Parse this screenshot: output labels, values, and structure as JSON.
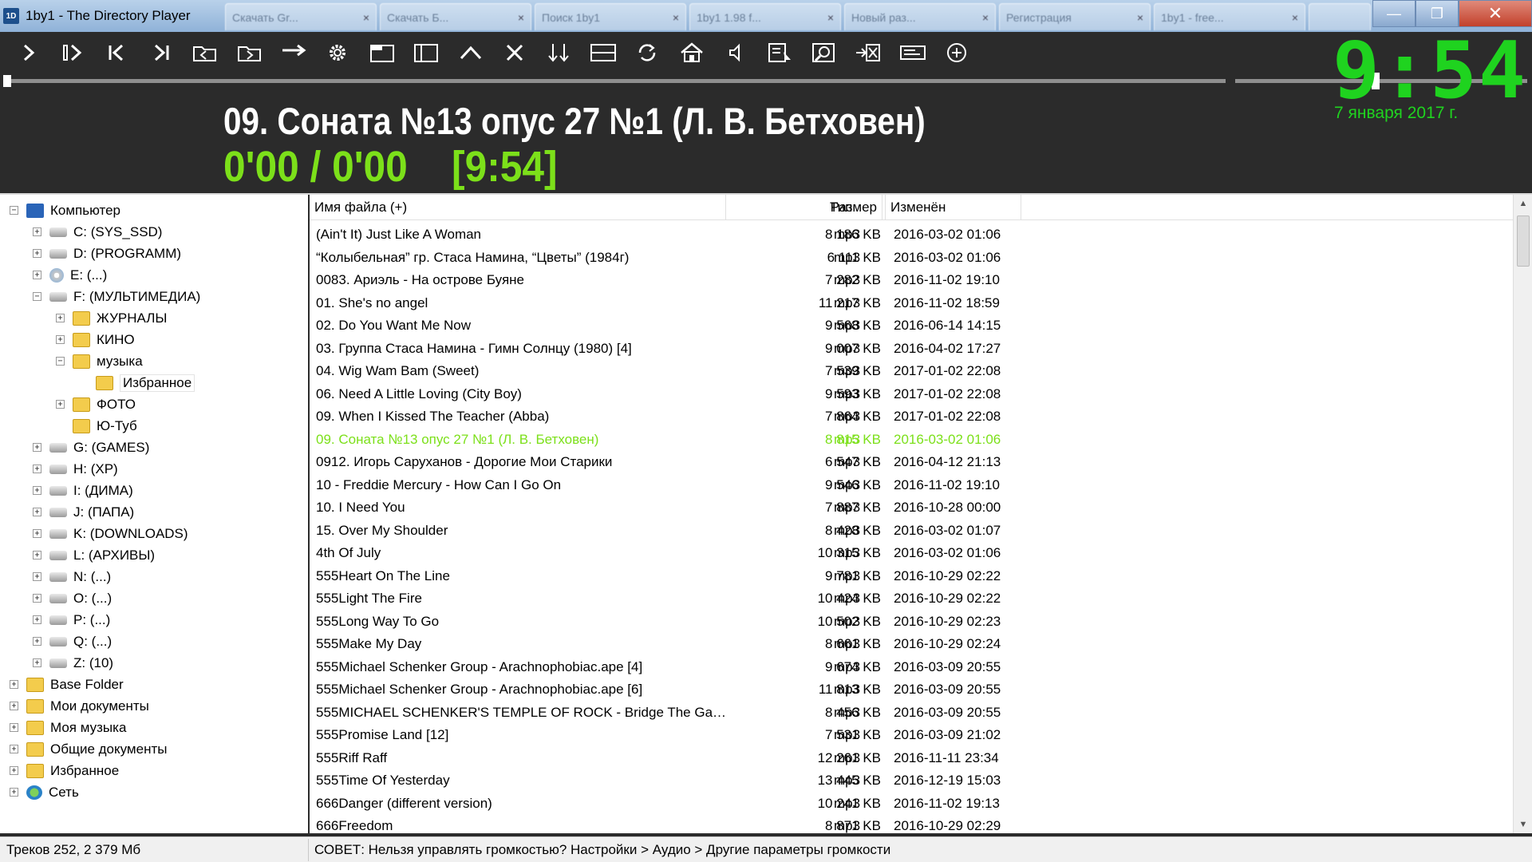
{
  "window": {
    "app_icon": "1D",
    "title": "1by1 - The Directory Player",
    "tabs": [
      {
        "label": "Скачать Gr..."
      },
      {
        "label": "Скачать Б..."
      },
      {
        "label": "Поиск 1by1"
      },
      {
        "label": "1by1 1.98 f..."
      },
      {
        "label": "Новый раз..."
      },
      {
        "label": "Регистрация"
      },
      {
        "label": "1by1 - free..."
      },
      {
        "label": ""
      }
    ],
    "minimize": "—",
    "restore": "❐",
    "close": "✕"
  },
  "toolbar": {
    "icons": [
      "play-icon",
      "play-pause-icon",
      "previous-track-icon",
      "next-track-icon",
      "back-folder-icon",
      "forward-folder-icon",
      "jump-icon",
      "settings-gear-icon",
      "window-layout-icon",
      "panel-icon",
      "up-icon",
      "stop-icon",
      "sort-icon",
      "split-view-icon",
      "refresh-icon",
      "home-icon",
      "volume-icon",
      "playlist-icon",
      "search-icon",
      "exit-icon",
      "keyboard-icon",
      "add-circle-icon"
    ],
    "seek_progress": 0,
    "volume_level": 0.48
  },
  "clock": {
    "time": "9:54",
    "date": "7 января 2017 г.",
    "color": "#1fd31f"
  },
  "now_playing": {
    "title": "09. Соната №13 опус 27 №1 (Л. В. Бетховен)",
    "position": "0'00 / 0'00    [9:54]",
    "color": "#7ce01a"
  },
  "tree": [
    {
      "label": "Компьютер",
      "level": 0,
      "expander": "−",
      "icon": "computer-icon"
    },
    {
      "label": "C: (SYS_SSD)",
      "level": 1,
      "expander": "+",
      "icon": "drive-icon"
    },
    {
      "label": "D: (PROGRAMM)",
      "level": 1,
      "expander": "+",
      "icon": "drive-icon"
    },
    {
      "label": "E: (...)",
      "level": 1,
      "expander": "+",
      "icon": "cd-drive-icon"
    },
    {
      "label": "F: (МУЛЬТИМЕДИА)",
      "level": 1,
      "expander": "−",
      "icon": "drive-icon"
    },
    {
      "label": "ЖУРНАЛЫ",
      "level": 2,
      "expander": "+",
      "icon": "folder-icon"
    },
    {
      "label": "КИНО",
      "level": 2,
      "expander": "+",
      "icon": "folder-icon"
    },
    {
      "label": "музыка",
      "level": 2,
      "expander": "−",
      "icon": "folder-icon"
    },
    {
      "label": "Избранное",
      "level": 3,
      "expander": "",
      "icon": "folder-icon",
      "selected": true
    },
    {
      "label": "ФОТО",
      "level": 2,
      "expander": "+",
      "icon": "folder-icon"
    },
    {
      "label": "Ю-Туб",
      "level": 2,
      "expander": "",
      "icon": "folder-icon"
    },
    {
      "label": "G: (GAMES)",
      "level": 1,
      "expander": "+",
      "icon": "drive-icon"
    },
    {
      "label": "H: (XP)",
      "level": 1,
      "expander": "+",
      "icon": "drive-icon"
    },
    {
      "label": "I: (ДИМА)",
      "level": 1,
      "expander": "+",
      "icon": "drive-icon"
    },
    {
      "label": "J: (ПАПА)",
      "level": 1,
      "expander": "+",
      "icon": "drive-icon"
    },
    {
      "label": "K: (DOWNLOADS)",
      "level": 1,
      "expander": "+",
      "icon": "drive-icon"
    },
    {
      "label": "L: (АРХИВЫ)",
      "level": 1,
      "expander": "+",
      "icon": "drive-icon"
    },
    {
      "label": "N: (...)",
      "level": 1,
      "expander": "+",
      "icon": "drive-icon"
    },
    {
      "label": "O: (...)",
      "level": 1,
      "expander": "+",
      "icon": "drive-icon"
    },
    {
      "label": "P: (...)",
      "level": 1,
      "expander": "+",
      "icon": "drive-icon"
    },
    {
      "label": "Q: (...)",
      "level": 1,
      "expander": "+",
      "icon": "drive-icon"
    },
    {
      "label": "Z: (10)",
      "level": 1,
      "expander": "+",
      "icon": "drive-icon"
    },
    {
      "label": "Base Folder",
      "level": 0,
      "expander": "+",
      "icon": "folder-icon"
    },
    {
      "label": "Мои документы",
      "level": 0,
      "expander": "+",
      "icon": "folder-icon"
    },
    {
      "label": "Моя музыка",
      "level": 0,
      "expander": "+",
      "icon": "folder-icon"
    },
    {
      "label": "Общие документы",
      "level": 0,
      "expander": "+",
      "icon": "folder-icon"
    },
    {
      "label": "Избранное",
      "level": 0,
      "expander": "+",
      "icon": "folder-icon"
    },
    {
      "label": "Сеть",
      "level": 0,
      "expander": "+",
      "icon": "network-icon"
    }
  ],
  "list": {
    "columns": {
      "name": "Имя файла (+)",
      "size": "Размер",
      "type": "Тип",
      "modified": "Изменён"
    },
    "rows": [
      {
        "name": "(Ain't It) Just Like A Woman",
        "size": "8 186 KB",
        "type": "mp3",
        "modified": "2016-03-02 01:06"
      },
      {
        "name": "“Колыбельная” гр. Стаса Намина, “Цветы” (1984г)",
        "size": "6 111 KB",
        "type": "mp3",
        "modified": "2016-03-02 01:06"
      },
      {
        "name": "0083. Ариэль - На острове Буяне",
        "size": "7 282 KB",
        "type": "mp3",
        "modified": "2016-11-02 19:10"
      },
      {
        "name": "01. She's no angel",
        "size": "11 217 KB",
        "type": "mp3",
        "modified": "2016-11-02 18:59"
      },
      {
        "name": "02. Do You Want Me Now",
        "size": "9 568 KB",
        "type": "mp3",
        "modified": "2016-06-14 14:15"
      },
      {
        "name": "03. Группа Стаса Намина - Гимн Солнцу (1980) [4]",
        "size": "9 007 KB",
        "type": "mp3",
        "modified": "2016-04-02 17:27"
      },
      {
        "name": "04. Wig Wam Bam (Sweet)",
        "size": "7 539 KB",
        "type": "mp3",
        "modified": "2017-01-02 22:08"
      },
      {
        "name": "06. Need A Little Loving (City Boy)",
        "size": "9 593 KB",
        "type": "mp3",
        "modified": "2017-01-02 22:08"
      },
      {
        "name": "09. When I Kissed The Teacher (Abba)",
        "size": "7 864 KB",
        "type": "mp3",
        "modified": "2017-01-02 22:08"
      },
      {
        "name": "09. Соната №13 опус 27 №1 (Л. В. Бетховен)",
        "size": "8 815 KB",
        "type": "mp3",
        "modified": "2016-03-02 01:06",
        "playing": true
      },
      {
        "name": "0912. Игорь Саруханов - Дорогие Мои Старики",
        "size": "6 547 KB",
        "type": "mp3",
        "modified": "2016-04-12 21:13"
      },
      {
        "name": "10 - Freddie Mercury - How Can I Go On",
        "size": "9 546 KB",
        "type": "mp3",
        "modified": "2016-11-02 19:10"
      },
      {
        "name": "10. I Need You",
        "size": "7 887 KB",
        "type": "mp3",
        "modified": "2016-10-28 00:00"
      },
      {
        "name": "15. Over My Shoulder",
        "size": "8 428 KB",
        "type": "mp3",
        "modified": "2016-03-02 01:07"
      },
      {
        "name": "4th Of July",
        "size": "10 315 KB",
        "type": "mp3",
        "modified": "2016-03-02 01:06"
      },
      {
        "name": "555Heart On The Line",
        "size": "9 781 KB",
        "type": "mp3",
        "modified": "2016-10-29 02:22"
      },
      {
        "name": "555Light The Fire",
        "size": "10 424 KB",
        "type": "mp3",
        "modified": "2016-10-29 02:22"
      },
      {
        "name": "555Long Way To Go",
        "size": "10 502 KB",
        "type": "mp3",
        "modified": "2016-10-29 02:23"
      },
      {
        "name": "555Make My Day",
        "size": "8 661 KB",
        "type": "mp3",
        "modified": "2016-10-29 02:24"
      },
      {
        "name": "555Michael Schenker Group - Arachnophobiac.ape [4]",
        "size": "9 674 KB",
        "type": "mp3",
        "modified": "2016-03-09 20:55"
      },
      {
        "name": "555Michael Schenker Group - Arachnophobiac.ape [6]",
        "size": "11 813 KB",
        "type": "mp3",
        "modified": "2016-03-09 20:55"
      },
      {
        "name": "555MICHAEL SCHENKER'S TEMPLE OF ROCK - Bridge The Gap ...",
        "size": "8 456 KB",
        "type": "mp3",
        "modified": "2016-03-09 20:55"
      },
      {
        "name": "555Promise Land [12]",
        "size": "7 531 KB",
        "type": "mp3",
        "modified": "2016-03-09 21:02"
      },
      {
        "name": "555Riff Raff",
        "size": "12 261 KB",
        "type": "mp3",
        "modified": "2016-11-11 23:34"
      },
      {
        "name": "555Time Of Yesterday",
        "size": "13 445 KB",
        "type": "mp3",
        "modified": "2016-12-19 15:03"
      },
      {
        "name": "666Danger (different version)",
        "size": "10 241 KB",
        "type": "mp3",
        "modified": "2016-11-02 19:13"
      },
      {
        "name": "666Freedom",
        "size": "8 871 KB",
        "type": "mp3",
        "modified": "2016-10-29 02:29"
      }
    ]
  },
  "scrollbar": {
    "up": "▲",
    "down": "▼"
  },
  "status": {
    "tracks": "Треков 252, 2 379 Мб",
    "tip": "СОВЕТ: Нельзя управлять громкостью? Настройки > Аудио > Другие параметры громкости"
  }
}
